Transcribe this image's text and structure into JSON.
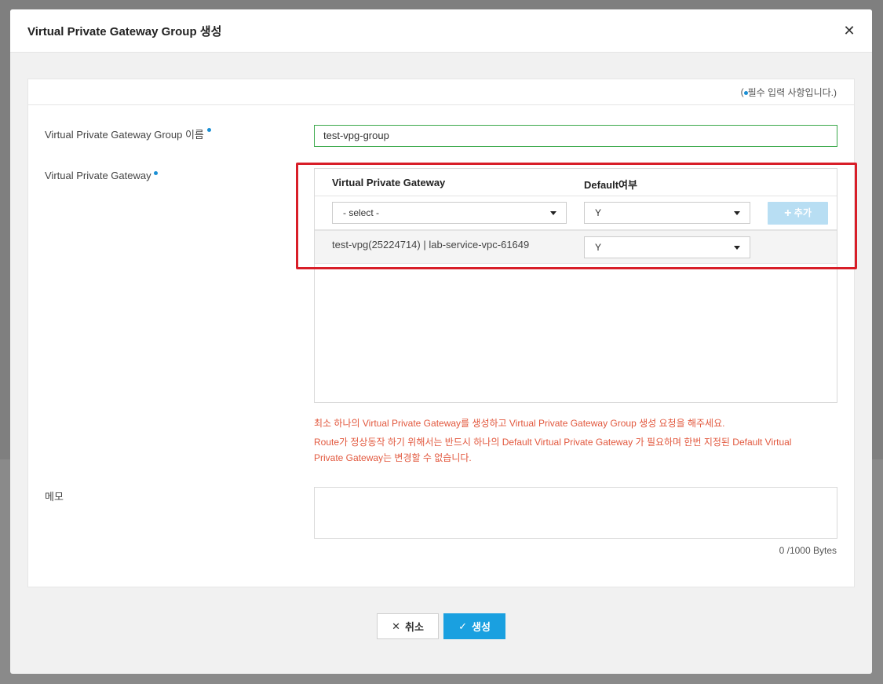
{
  "dialog": {
    "title": "Virtual Private Gateway Group 생성",
    "close_icon": "close-icon"
  },
  "required_note": {
    "prefix": "(",
    "text": "필수 입력 사항입니다.)"
  },
  "form": {
    "name_label": "Virtual Private Gateway Group 이름",
    "name_value": "test-vpg-group",
    "vpg_label": "Virtual Private Gateway",
    "memo_label": "메모",
    "memo_value": "",
    "bytes_counter": "0 /1000 Bytes"
  },
  "vpg_table": {
    "col_vpg": "Virtual Private Gateway",
    "col_default": "Default여부",
    "add_row": {
      "vpg_select": "- select -",
      "default_select": "Y",
      "add_button": "추가"
    },
    "rows": [
      {
        "name": "test-vpg(25224714) | lab-service-vpc-61649",
        "default": "Y"
      }
    ]
  },
  "warnings": [
    "최소 하나의 Virtual Private Gateway를 생성하고 Virtual Private Gateway Group 생성 요청을 해주세요.",
    "Route가 정상동작 하기 위해서는 반드시 하나의 Default Virtual Private Gateway 가 필요하며 한번 지정된 Default Virtual",
    "Private Gateway는 변경할 수 없습니다."
  ],
  "footer": {
    "cancel_label": "취소",
    "create_label": "생성"
  },
  "colors": {
    "accent": "#1aa0e0",
    "warning": "#e2583e",
    "highlight": "#d81e28",
    "valid_border": "#3aa84a"
  }
}
